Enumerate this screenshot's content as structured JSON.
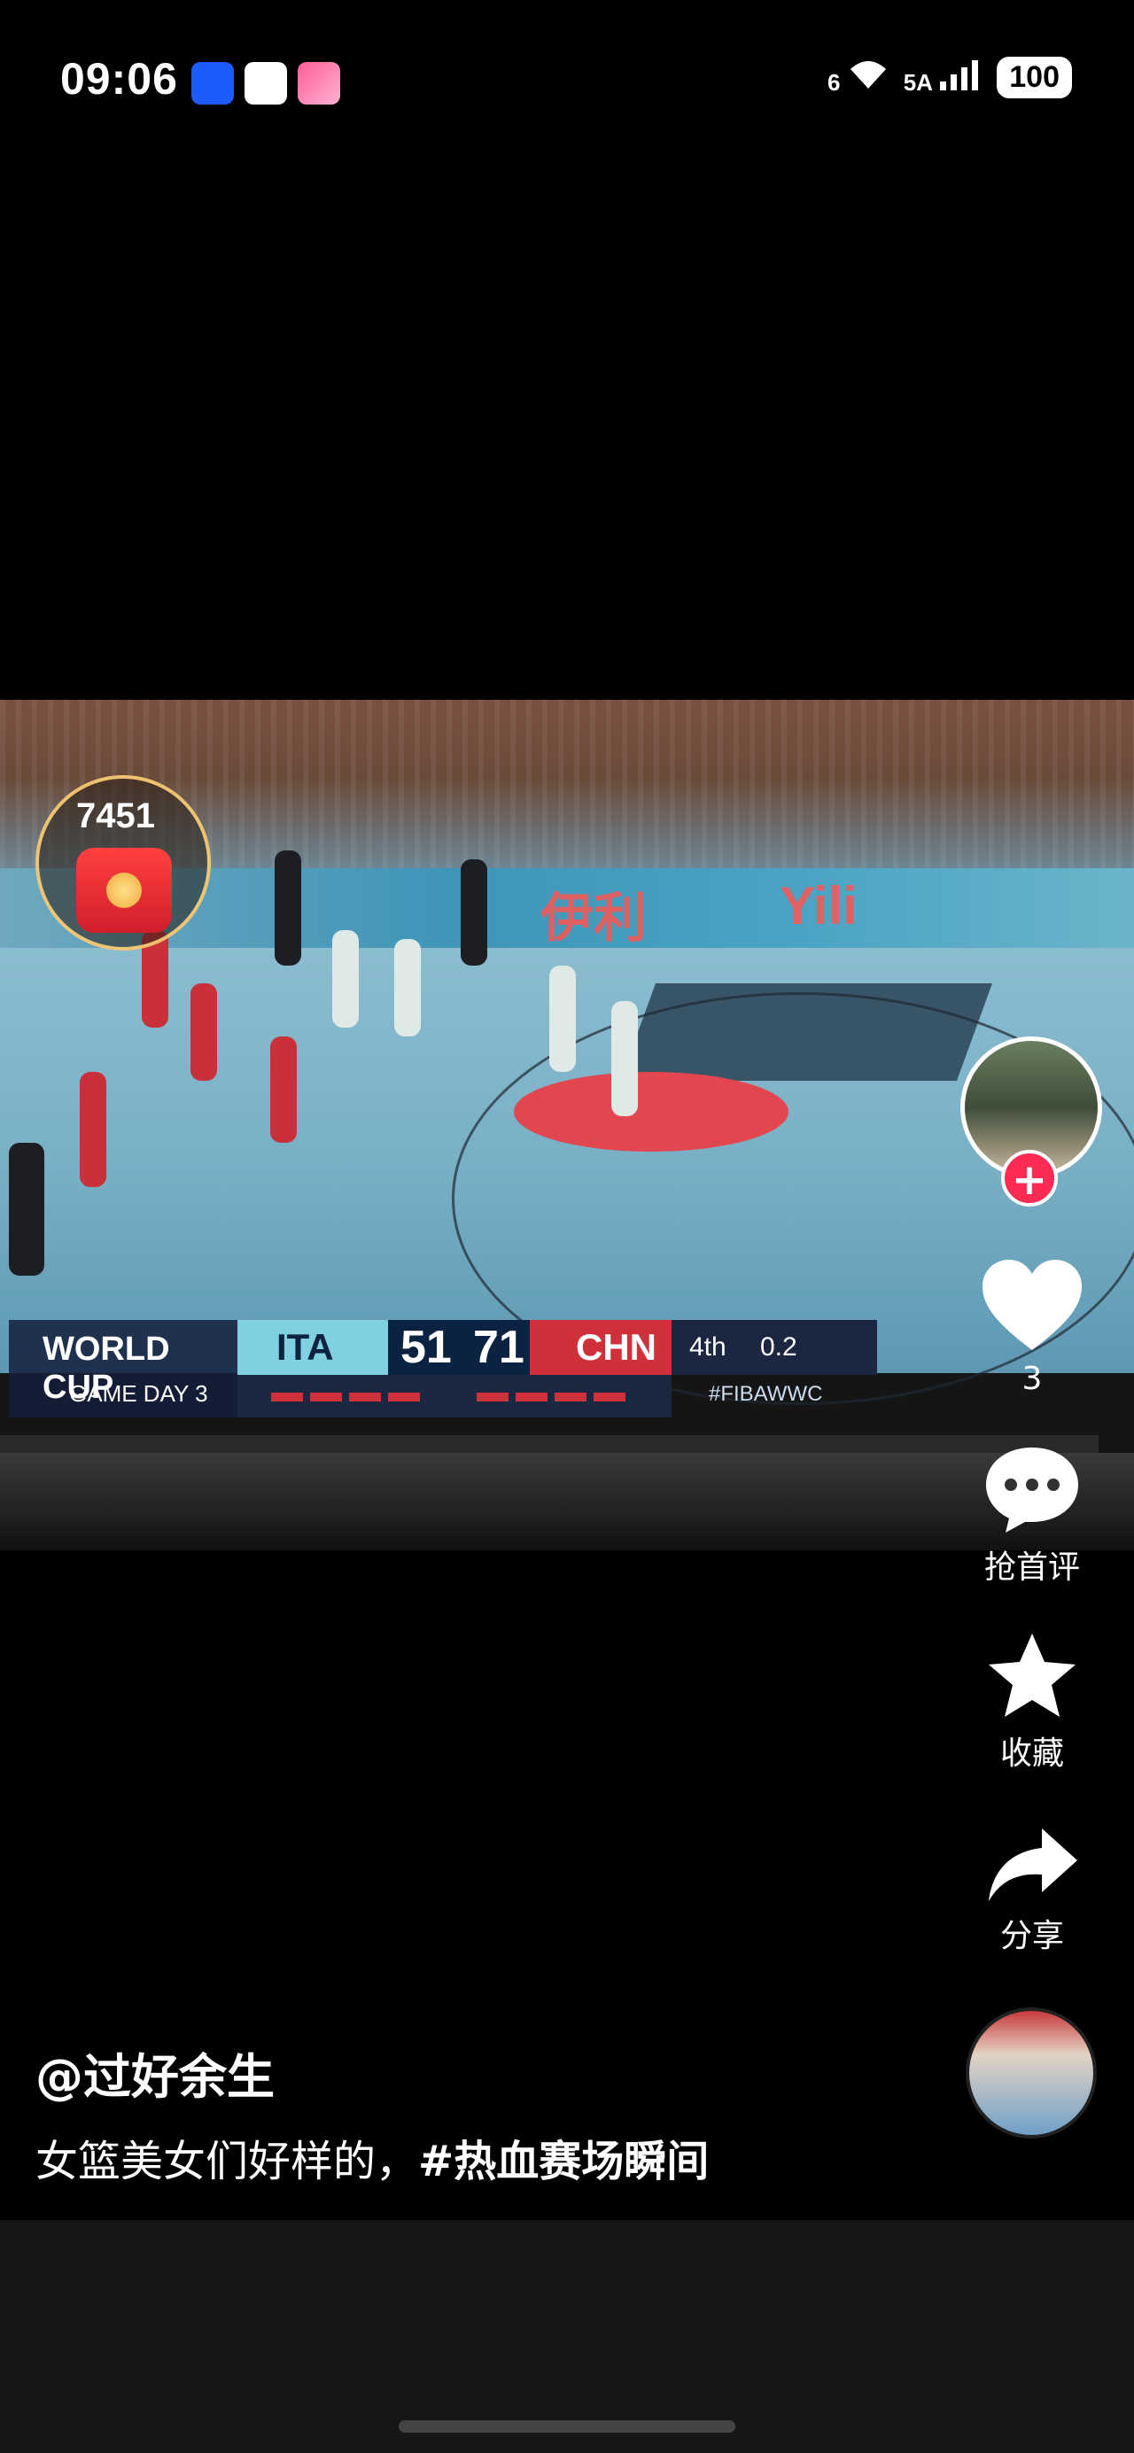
{
  "status_bar": {
    "time": "09:06",
    "icons": [
      "bulb-icon",
      "bank-icon",
      "app-icon"
    ],
    "wifi_label": "6",
    "network_label": "5A",
    "battery": "100"
  },
  "video": {
    "scorebug": {
      "event": "WORLD CUP",
      "game_day": "GAME DAY 3",
      "home_team": "ITA",
      "home_score": "51",
      "away_score": "71",
      "away_team": "CHN",
      "period": "4th",
      "clock": "0.2",
      "hashtag": "#FIBAWWC"
    },
    "ad_text_1": "伊利",
    "ad_text_2": "Yili"
  },
  "red_packet": {
    "count": "7451"
  },
  "actions": {
    "like_count": "3",
    "comment_label": "抢首评",
    "favorite_label": "收藏",
    "share_label": "分享"
  },
  "post": {
    "author": "@过好余生",
    "caption_text": "女篮美女们好样的，",
    "caption_tag": "#热血赛场瞬间"
  },
  "colors": {
    "background": "#000000",
    "follow_button": "#fe2c55",
    "like_icon": "#ffffff"
  }
}
